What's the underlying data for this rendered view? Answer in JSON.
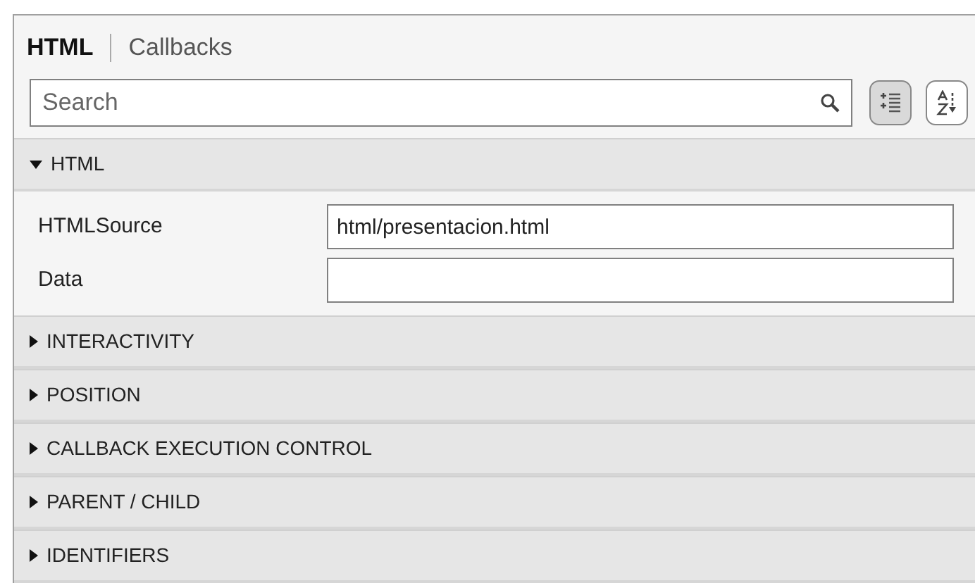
{
  "tabs": [
    {
      "label": "HTML",
      "selected": true
    },
    {
      "label": "Callbacks",
      "selected": false
    }
  ],
  "search": {
    "placeholder": "Search"
  },
  "view_buttons": [
    {
      "kind": "grouped",
      "selected": true
    },
    {
      "kind": "alphabetical",
      "selected": false
    }
  ],
  "sections": [
    {
      "title": "HTML",
      "expanded": true,
      "properties": [
        {
          "name": "HTMLSource",
          "value": "html/presentacion.html"
        },
        {
          "name": "Data"
        }
      ]
    },
    {
      "title": "INTERACTIVITY",
      "expanded": false
    },
    {
      "title": "POSITION",
      "expanded": false
    },
    {
      "title": "CALLBACK EXECUTION CONTROL",
      "expanded": false
    },
    {
      "title": "PARENT / CHILD",
      "expanded": false
    },
    {
      "title": "IDENTIFIERS",
      "expanded": false
    }
  ]
}
